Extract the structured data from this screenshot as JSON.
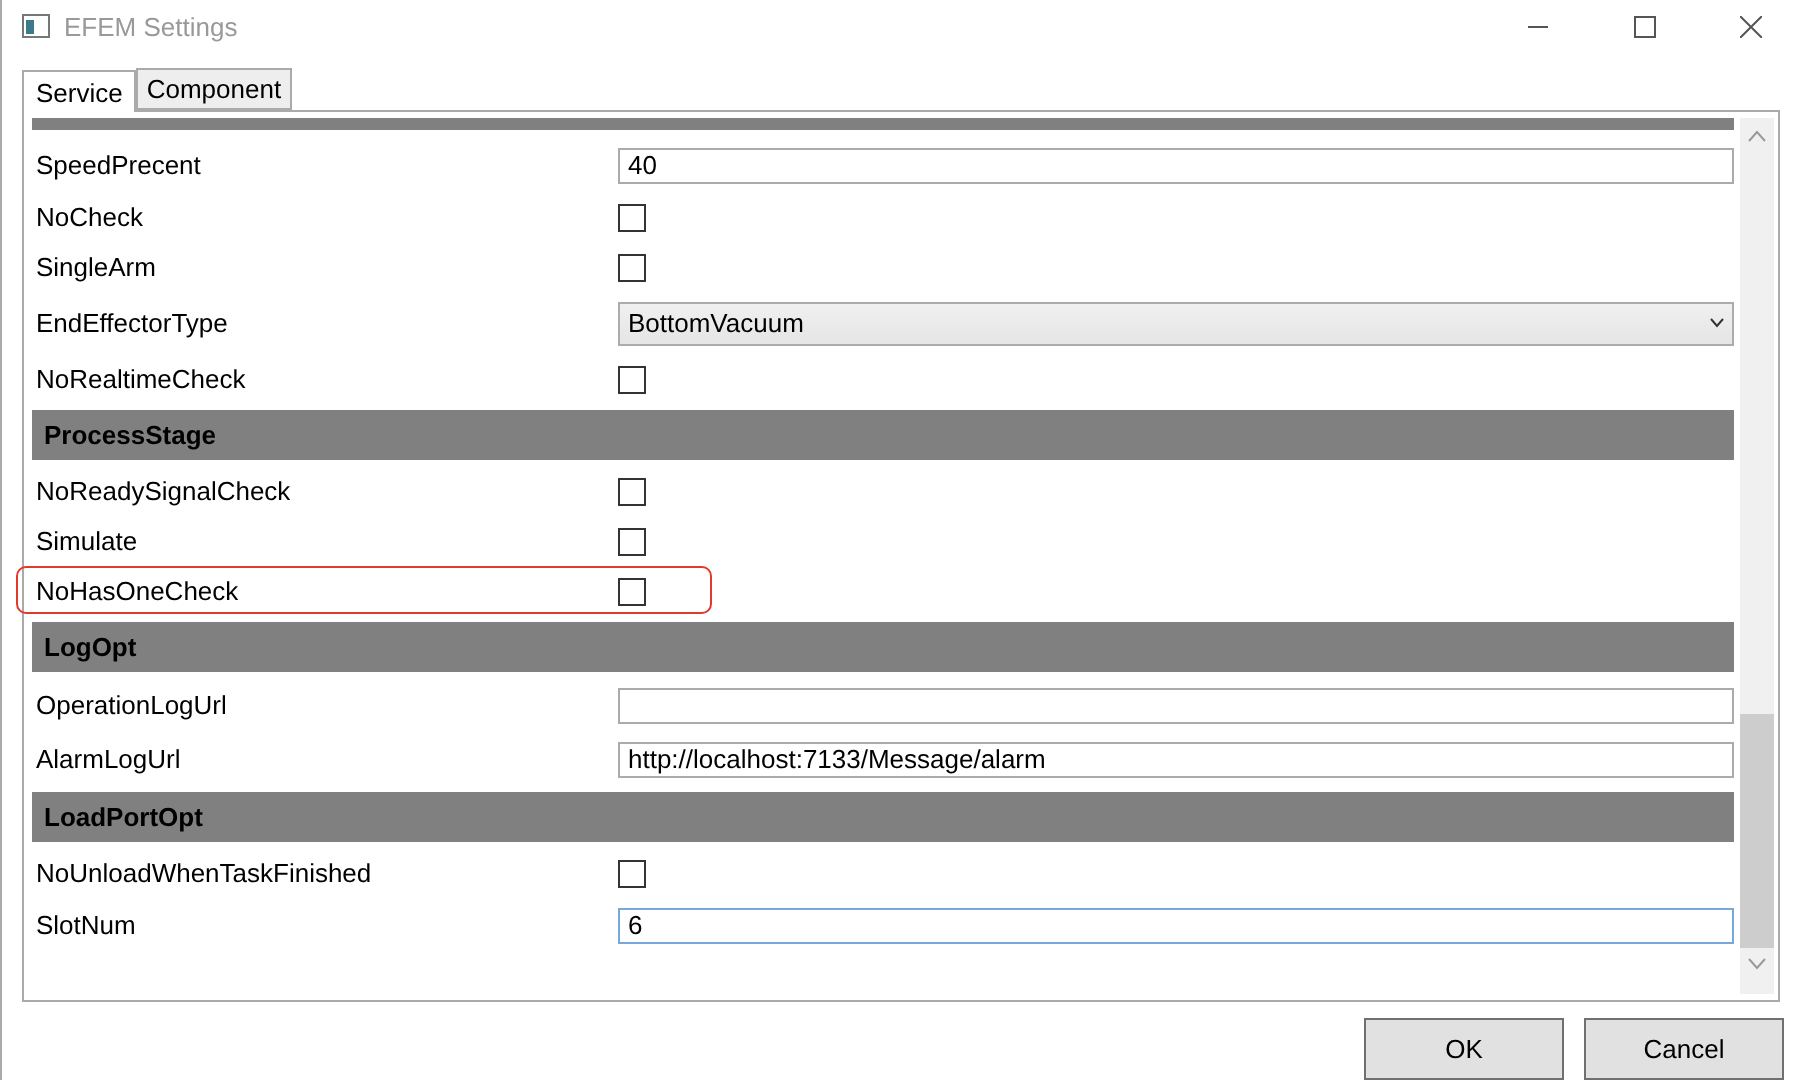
{
  "window": {
    "title": "EFEM Settings"
  },
  "tabs": [
    {
      "label": "Service",
      "selected": true
    },
    {
      "label": "Component",
      "selected": false
    }
  ],
  "properties": [
    {
      "kind": "text",
      "label": "SpeedPrecent",
      "value": "40",
      "focused": false
    },
    {
      "kind": "checkbox",
      "label": "NoCheck",
      "checked": false,
      "highlighted": false
    },
    {
      "kind": "checkbox",
      "label": "SingleArm",
      "checked": false,
      "highlighted": false
    },
    {
      "kind": "select",
      "label": "EndEffectorType",
      "value": "BottomVacuum"
    },
    {
      "kind": "checkbox",
      "label": "NoRealtimeCheck",
      "checked": false,
      "highlighted": false
    },
    {
      "kind": "header",
      "label": "ProcessStage"
    },
    {
      "kind": "checkbox",
      "label": "NoReadySignalCheck",
      "checked": false,
      "highlighted": false
    },
    {
      "kind": "checkbox",
      "label": "Simulate",
      "checked": false,
      "highlighted": false
    },
    {
      "kind": "checkbox",
      "label": "NoHasOneCheck",
      "checked": false,
      "highlighted": true
    },
    {
      "kind": "header",
      "label": "LogOpt"
    },
    {
      "kind": "text",
      "label": "OperationLogUrl",
      "focused": false
    },
    {
      "kind": "text",
      "label": "AlarmLogUrl",
      "value": "http://localhost:7133/Message/alarm",
      "focused": false
    },
    {
      "kind": "header",
      "label": "LoadPortOpt"
    },
    {
      "kind": "checkbox",
      "label": "NoUnloadWhenTaskFinished",
      "checked": false,
      "highlighted": false
    },
    {
      "kind": "text",
      "label": "SlotNum",
      "value": "6",
      "focused": true
    }
  ],
  "buttons": [
    "OK",
    "Cancel"
  ]
}
